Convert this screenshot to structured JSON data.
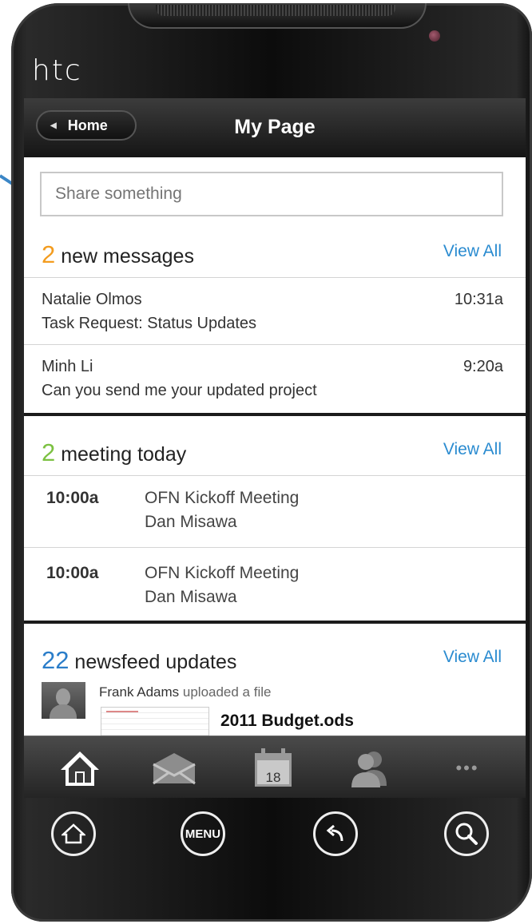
{
  "phone": {
    "brand": "htc"
  },
  "header": {
    "back_label": "Home",
    "title": "My Page"
  },
  "share": {
    "placeholder": "Share something"
  },
  "messages": {
    "count": "2",
    "label": " new messages",
    "view_all": "View All",
    "items": [
      {
        "sender": "Natalie Olmos",
        "subject": "Task Request: Status Updates",
        "time": "10:31a"
      },
      {
        "sender": "Minh Li",
        "subject": "Can you send me your updated project",
        "time": "9:20a"
      }
    ]
  },
  "meetings": {
    "count": "2",
    "label": " meeting today",
    "view_all": "View All",
    "items": [
      {
        "time": "10:00a",
        "title": "OFN Kickoff Meeting",
        "owner": "Dan Misawa"
      },
      {
        "time": "10:00a",
        "title": "OFN Kickoff Meeting",
        "owner": "Dan Misawa"
      }
    ]
  },
  "newsfeed": {
    "count": "22",
    "label": " newsfeed updates",
    "view_all": "View All",
    "item": {
      "user": "Frank Adams",
      "action": " uploaded a file",
      "file": "2011 Budget.ods"
    }
  },
  "tabbar": {
    "calendar_day": "18",
    "items": [
      "home-icon",
      "mail-icon",
      "calendar-icon",
      "contacts-icon",
      "more-icon"
    ],
    "more_glyph": "•••"
  },
  "hardware_keys": {
    "menu_label": "MENU"
  },
  "colors": {
    "messages_count": "#f39c1f",
    "meetings_count": "#7cc142",
    "newsfeed_count": "#2a7dc9",
    "link": "#2a8bd0"
  }
}
